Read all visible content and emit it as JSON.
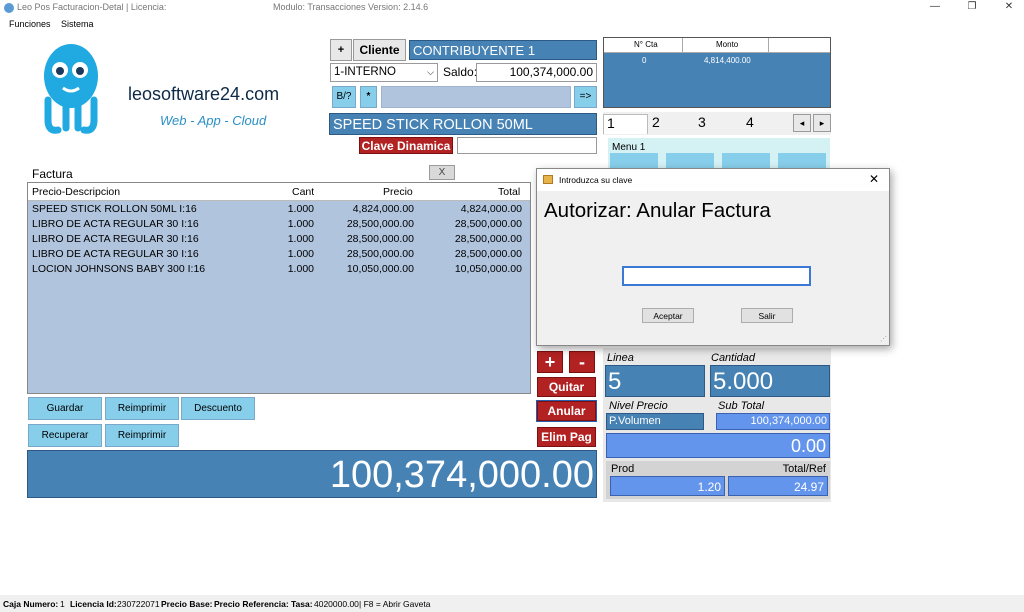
{
  "title_bar": {
    "app_title": "Leo Pos Facturacion-Detal | Licencia:",
    "module_title": "Modulo: Transacciones Version:  2.14.6",
    "minimize_glyph": "—",
    "restore_glyph": "❐",
    "close_glyph": "✕"
  },
  "menu": {
    "funciones": "Funciones",
    "sistema": "Sistema"
  },
  "logo": {
    "site": "leosoftware24.com",
    "tagline": "Web - App - Cloud"
  },
  "client": {
    "plus": "+",
    "cliente_label": "Cliente",
    "cliente_value": "CONTRIBUYENTE 1",
    "type_select": "1-INTERNO",
    "saldo_label": "Saldo:",
    "saldo_value": "100,374,000.00",
    "search_btn": "B/?",
    "star_btn": "*",
    "arrow_btn": "=>",
    "product_name": "SPEED STICK ROLLON 50ML",
    "clave_dinamica": "Clave Dinamica"
  },
  "quotas": {
    "headers": [
      "N° Cta",
      "Monto"
    ],
    "rows": [
      [
        "0",
        "4,814,400.00"
      ]
    ]
  },
  "tabs": [
    "1",
    "2",
    "3",
    "4"
  ],
  "menu_panel": {
    "label": "Menu 1"
  },
  "invoice": {
    "label": "Factura",
    "close": "X",
    "headers": {
      "desc": "Precio-Descripcion",
      "cant": "Cant",
      "precio": "Precio",
      "total": "Total"
    },
    "rows": [
      {
        "desc": "SPEED STICK ROLLON 50ML I:16",
        "cant": "1.000",
        "precio": "4,824,000.00",
        "total": "4,824,000.00"
      },
      {
        "desc": "LIBRO DE ACTA REGULAR 30 I:16",
        "cant": "1.000",
        "precio": "28,500,000.00",
        "total": "28,500,000.00"
      },
      {
        "desc": "LIBRO DE ACTA REGULAR 30 I:16",
        "cant": "1.000",
        "precio": "28,500,000.00",
        "total": "28,500,000.00"
      },
      {
        "desc": "LIBRO DE ACTA REGULAR 30 I:16",
        "cant": "1.000",
        "precio": "28,500,000.00",
        "total": "28,500,000.00"
      },
      {
        "desc": "LOCION JOHNSONS BABY 300 I:16",
        "cant": "1.000",
        "precio": "10,050,000.00",
        "total": "10,050,000.00"
      }
    ]
  },
  "actions": {
    "guardar": "Guardar",
    "reimprimir1": "Reimprimir",
    "descuento": "Descuento",
    "recuperar": "Recuperar",
    "reimprimir2": "Reimprimir",
    "plus": "+",
    "minus": "-",
    "quitar": "Quitar",
    "anular": "Anular",
    "elim_pag": "Elim Pag"
  },
  "grand_total": "100,374,000.00",
  "summary": {
    "linea_label": "Linea",
    "linea_value": "5",
    "cantidad_label": "Cantidad",
    "cantidad_value": "5.000",
    "nivel_label": "Nivel Precio",
    "nivel_value": "P.Volumen",
    "subtotal_label": "Sub Total",
    "subtotal_value": "100,374,000.00",
    "zero_value": "0.00",
    "prod_label": "Prod",
    "prod_value": "1.20",
    "totalref_label": "Total/Ref",
    "totalref_value": "24.97"
  },
  "dialog": {
    "title": "Introduzca su clave",
    "close": "✕",
    "heading": "Autorizar: Anular Factura",
    "input_value": "",
    "aceptar": "Aceptar",
    "salir": "Salir"
  },
  "status": {
    "caja_label": "Caja Numero:",
    "caja_value": "1",
    "licencia_label": "Licencia Id:",
    "licencia_value": "230722071",
    "precio_base": "Precio Base:",
    "precio_ref": "Precio Referencia:",
    "tasa_label": "Tasa:",
    "tasa_value": "4020000.00",
    "shortcut": "| F8 = Abrir Gaveta"
  }
}
